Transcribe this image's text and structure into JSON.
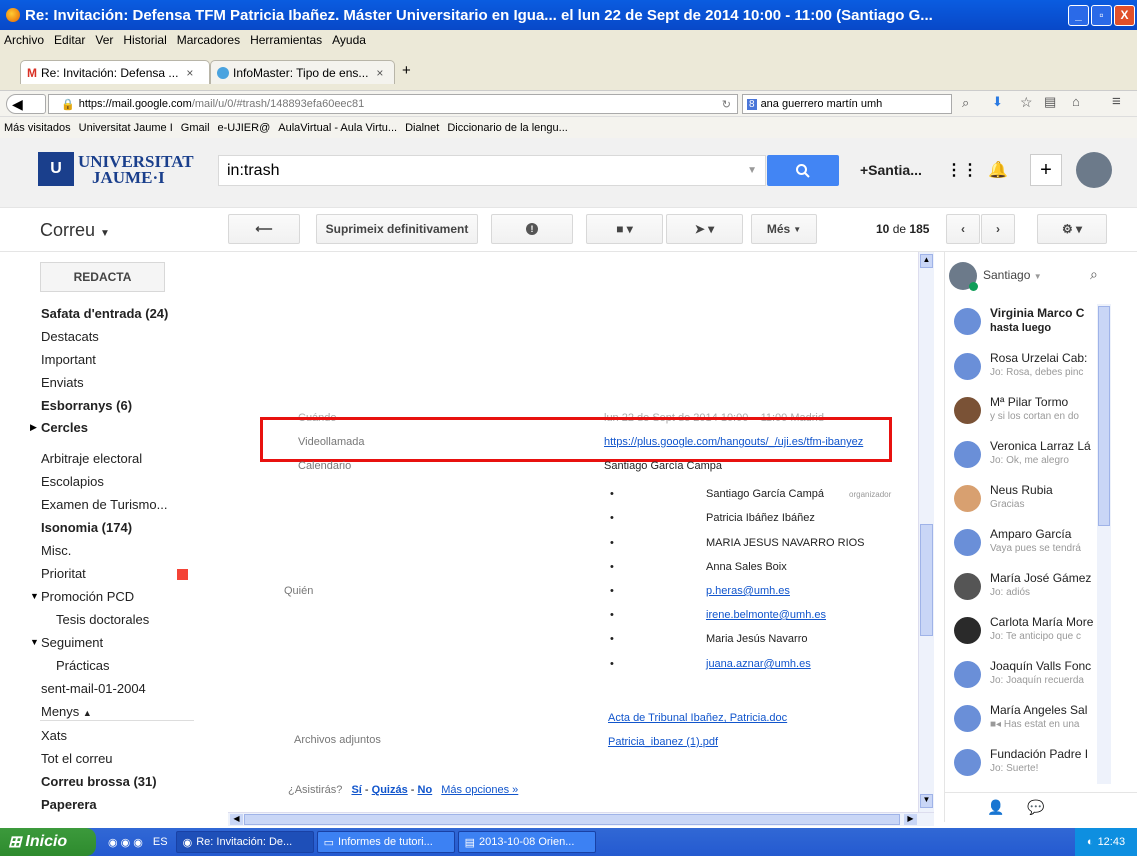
{
  "window": {
    "title": "Re: Invitación: Defensa TFM Patricia Ibañez. Máster Universitario en Igua... el lun 22 de Sept de 2014 10:00 - 11:00 (Santiago G...",
    "min": "_",
    "max": "▫",
    "close": "X"
  },
  "menu": [
    "Archivo",
    "Editar",
    "Ver",
    "Historial",
    "Marcadores",
    "Herramientas",
    "Ayuda"
  ],
  "tabs": [
    {
      "label": "Re: Invitación: Defensa ...",
      "close": "×"
    },
    {
      "label": "InfoMaster: Tipo de ens...",
      "close": "×"
    }
  ],
  "new_tab": "+",
  "url": "https://mail.google.com/mail/u/0/#trash/148893efa60eec81",
  "url_host": "https://mail.google.com",
  "url_path": "/mail/u/0/#trash/148893efa60eec81",
  "search_engine_query": "ana guerrero martín umh",
  "bookmarks": [
    "Más visitados",
    "Universitat Jaume I",
    "Gmail",
    "e-UJIER@",
    "AulaVirtual - Aula Virtu...",
    "Dialnet",
    "Diccionario de la lengu..."
  ],
  "logo": {
    "line1": "UNIVERSITAT",
    "line2": "JAUME·I"
  },
  "search": {
    "value": "in:trash"
  },
  "account": {
    "name": "+Santia..."
  },
  "header_icons": {
    "add": "+"
  },
  "correu": "Correu",
  "toolbar": {
    "delete_forever": "Suprimeix definitivament",
    "more": "Més",
    "count_current": "10",
    "count_sep": "de",
    "count_total": "185"
  },
  "compose": "REDACTA",
  "nav": [
    "Safata d'entrada (24)",
    "Destacats",
    "Important",
    "Enviats",
    "Esborranys (6)",
    "Cercles",
    "Arbitraje electoral",
    "Escolapios",
    "Examen de Turismo...",
    "Isonomia (174)",
    "Misc.",
    "Prioritat",
    "Promoción PCD",
    "Tesis doctorales",
    "Seguiment",
    "Prácticas",
    "sent-mail-01-2004",
    "Menys",
    "Xats",
    "Tot el correu",
    "Correu brossa (31)",
    "Paperera"
  ],
  "event": {
    "when_label": "Cuándo",
    "when_value": "lun 22 de Sept de 2014 10:00 – 11:00 Madrid",
    "video_label": "Videollamada",
    "video_link": "https://plus.google.com/hangouts/_/uji.es/tfm-ibanyez",
    "calendar_label": "Calendario",
    "calendar_value": "Santiago García Campa",
    "who_label": "Quién",
    "guests": [
      "Santiago García Campá",
      "Patricia Ibáñez Ibáñez",
      "MARIA JESUS NAVARRO RIOS",
      "Anna Sales Boix",
      "p.heras@umh.es",
      "irene.belmonte@umh.es",
      "Maria Jesús Navarro",
      "juana.aznar@umh.es"
    ],
    "organizer": "organizador",
    "attachments_label": "Archivos adjuntos",
    "attachments": [
      "Acta de Tribunal Ibañez, Patricia.doc",
      "Patricia_ibanez (1).pdf"
    ],
    "rsvp": {
      "question": "¿Asistirás?",
      "yes": "Sí",
      "maybe": "Quizás",
      "no": "No",
      "more": "Más opciones »"
    }
  },
  "chat": {
    "me": "Santiago",
    "contacts": [
      {
        "name": "Virginia Marco C",
        "status": "hasta luego"
      },
      {
        "name": "Rosa Urzelai Cab:",
        "status": "Jo: Rosa, debes pinc"
      },
      {
        "name": "Mª Pilar Tormo",
        "status": "y si los cortan en do"
      },
      {
        "name": "Veronica Larraz Lá",
        "status": "Jo: Ok, me alegro"
      },
      {
        "name": "Neus Rubia",
        "status": "Gracias"
      },
      {
        "name": "Amparo García",
        "status": "Vaya pues se tendrá"
      },
      {
        "name": "María José Gámez",
        "status": "Jo: adiós"
      },
      {
        "name": "Carlota María More",
        "status": "Jo: Te anticipo que c"
      },
      {
        "name": "Joaquín Valls Fonc",
        "status": "Jo: Joaquín recuerda"
      },
      {
        "name": "María Angeles Sal",
        "status": "Has estat en una"
      },
      {
        "name": "Fundación Padre I",
        "status": "Jo: Suerte!"
      }
    ]
  },
  "taskbar": {
    "start": "Inicio",
    "lang": "ES",
    "tasks": [
      "Re: Invitación: De...",
      "Informes de tutori...",
      "2013-10-08 Orien..."
    ],
    "clock": "12:43"
  },
  "colors": {
    "highlight_box": "#e8110f",
    "accent_blue": "#4285f4",
    "prioritat": "#f44336"
  }
}
